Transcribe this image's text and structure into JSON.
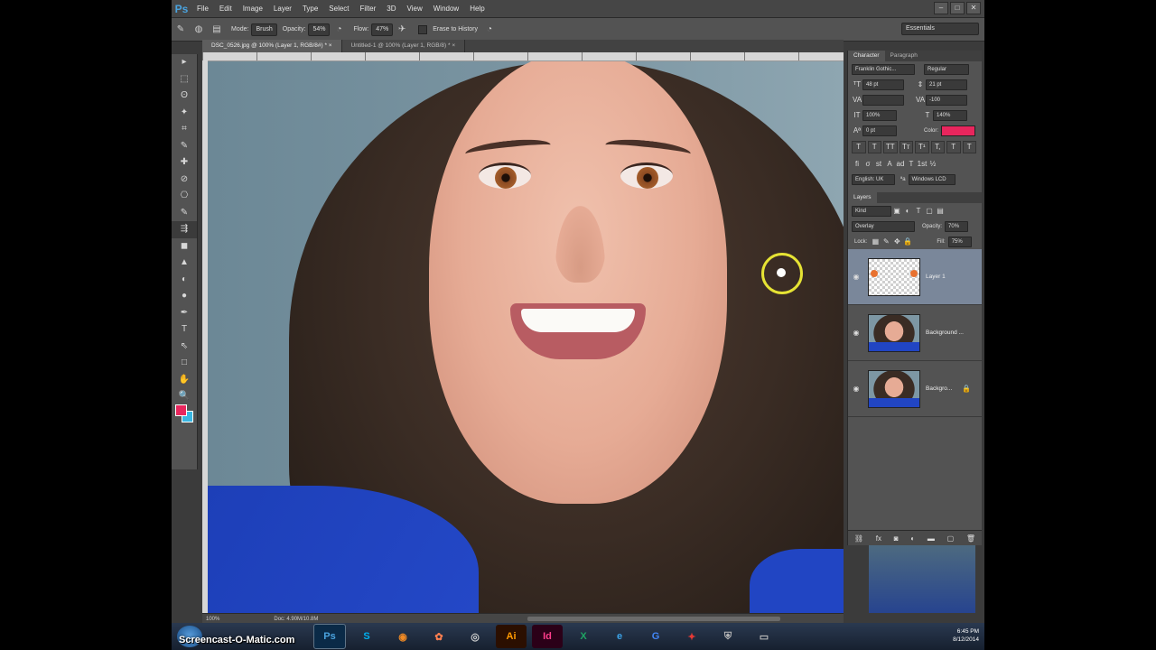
{
  "app": {
    "logo": "Ps"
  },
  "menu": [
    "File",
    "Edit",
    "Image",
    "Layer",
    "Type",
    "Select",
    "Filter",
    "3D",
    "View",
    "Window",
    "Help"
  ],
  "window_controls": [
    "–",
    "□",
    "✕"
  ],
  "options_bar": {
    "mode_label": "Mode:",
    "mode_value": "Brush",
    "opacity_label": "Opacity:",
    "opacity_value": "54%",
    "flow_label": "Flow:",
    "flow_value": "47%",
    "erase_history_label": "Erase to History",
    "workspace": "Essentials"
  },
  "document_tabs": [
    {
      "label": "DSC_0526.jpg @ 100% (Layer 1, RGB/8#) * ×",
      "active": true
    },
    {
      "label": "Untitled-1 @ 100% (Layer 1, RGB/8) * ×",
      "active": false
    }
  ],
  "tools": [
    "▸",
    "⬚",
    "ʘ",
    "✦",
    "⌗",
    "✎",
    "✚",
    "⊘",
    "⎔",
    "✎",
    "⇶",
    "◼",
    "▲",
    "◐",
    "●",
    "✒",
    "T",
    "⇖",
    "□",
    "✋",
    "🔍"
  ],
  "colors": {
    "foreground": "#e8265d",
    "background": "#39b6e2",
    "brush_cursor": "#e6e334"
  },
  "status": {
    "zoom": "100%",
    "doc": "Doc: 4.90M/10.8M"
  },
  "character_panel": {
    "tabs": [
      "Character",
      "Paragraph"
    ],
    "font_family": "Franklin Gothic...",
    "font_style": "Regular",
    "size": "48 pt",
    "leading": "21 pt",
    "tracking": "-100",
    "scale_v": "100%",
    "scale_h": "140%",
    "baseline": "0 pt",
    "color_label": "Color:",
    "type_buttons": [
      "T",
      "T",
      "TT",
      "Tт",
      "T¹",
      "T,",
      "T",
      "T"
    ],
    "language": "English: UK",
    "antialias": "Windows LCD"
  },
  "layers_panel": {
    "tab": "Layers",
    "kind": "Kind",
    "blend_mode": "Overlay",
    "opacity_label": "Opacity:",
    "opacity_value": "70%",
    "lock_label": "Lock:",
    "fill_label": "Fill:",
    "fill_value": "75%",
    "layers": [
      {
        "name": "Layer 1",
        "selected": true
      },
      {
        "name": "Background ...",
        "selected": false
      },
      {
        "name": "Backgro...",
        "selected": false
      }
    ],
    "footer_icons": [
      "link-icon",
      "fx-icon",
      "mask-icon",
      "adjustment-icon",
      "folder-icon",
      "new-layer-icon",
      "trash-icon"
    ]
  },
  "taskbar": {
    "watermark": "Screencast-O-Matic.com",
    "apps": [
      "Ps",
      "S",
      "◉",
      "✿",
      "◎",
      "Ai",
      "Id",
      "X",
      "e",
      "G",
      "✦",
      "⛨",
      "▭"
    ],
    "time": "6:45 PM",
    "date": "8/12/2014"
  }
}
